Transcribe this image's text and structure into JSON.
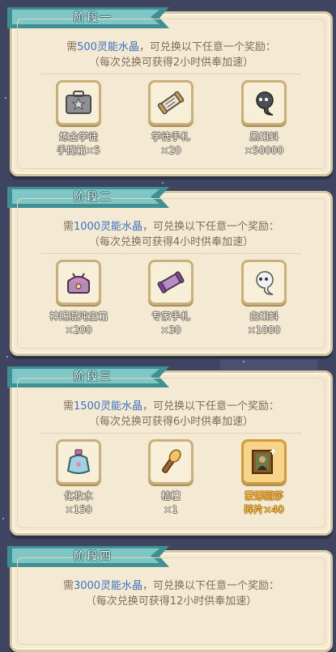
{
  "stages": [
    {
      "title": "阶段一",
      "desc_prefix": "需",
      "desc_highlight": "500灵能水晶",
      "desc_suffix": "，可兑换以下任意一个奖励：",
      "desc_line2": "（每次兑换可获得2小时供奉加速）",
      "rewards": [
        {
          "icon": "toolbox-icon",
          "name_line1": "炼金学徒",
          "name_line2": "手提箱×5",
          "count": ""
        },
        {
          "icon": "scroll-icon",
          "name_line1": "学徒手札",
          "name_line2": "",
          "count": "×20"
        },
        {
          "icon": "black-tadpole-icon",
          "name_line1": "黑蝌蚪",
          "name_line2": "",
          "count": "×50000"
        }
      ]
    },
    {
      "title": "阶段二",
      "desc_prefix": "需",
      "desc_highlight": "1000灵能水晶",
      "desc_suffix": "，可兑换以下任意一个奖励：",
      "desc_line2": "（每次兑换可获得4小时供奉加速）",
      "rewards": [
        {
          "icon": "chaos-chest-icon",
          "name_line1": "神赐混沌宝箱",
          "name_line2": "",
          "count": "×200"
        },
        {
          "icon": "expert-scroll-icon",
          "name_line1": "专家手札",
          "name_line2": "",
          "count": "×30"
        },
        {
          "icon": "white-tadpole-icon",
          "name_line1": "白蝌蚪",
          "name_line2": "",
          "count": "×1000"
        }
      ]
    },
    {
      "title": "阶段三",
      "desc_prefix": "需",
      "desc_highlight": "1500灵能水晶",
      "desc_suffix": "，可兑换以下任意一个奖励：",
      "desc_line2": "（每次兑换可获得6小时供奉加速）",
      "rewards": [
        {
          "icon": "perfume-bottle-icon",
          "name_line1": "化妆水",
          "name_line2": "",
          "count": "×150"
        },
        {
          "icon": "torch-icon",
          "name_line1": "桔檀",
          "name_line2": "",
          "count": "×1"
        },
        {
          "icon": "mona-lisa-painting-icon",
          "name_line1": "蒙娜丽莎",
          "name_line2": "",
          "count": "碎片×40",
          "rare": true
        }
      ]
    },
    {
      "title": "阶段四",
      "desc_prefix": "需",
      "desc_highlight": "3000灵能水晶",
      "desc_suffix": "，可兑换以下任意一个奖励：",
      "desc_line2": "（每次兑换可获得12小时供奉加速）",
      "rewards": []
    }
  ]
}
